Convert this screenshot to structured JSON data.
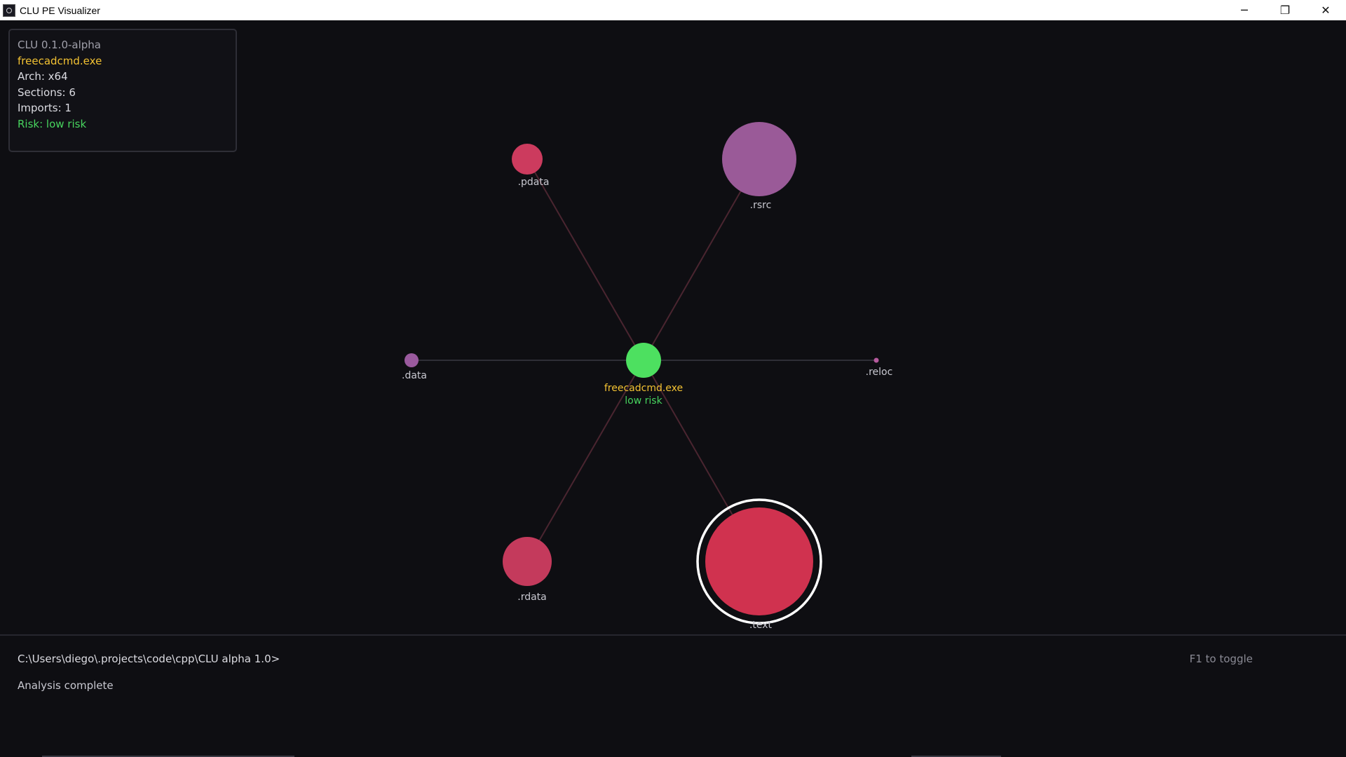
{
  "window": {
    "title": "CLU PE Visualizer",
    "minimize_glyph": "─",
    "maximize_glyph": "❐",
    "close_glyph": "✕"
  },
  "info": {
    "version": "CLU 0.1.0-alpha",
    "filename": "freecadcmd.exe",
    "arch": "Arch: x64",
    "sections": "Sections: 6",
    "imports": "Imports: 1",
    "risk": "Risk: low risk"
  },
  "graph": {
    "center": {
      "label": "freecadcmd.exe",
      "sublabel": "low risk",
      "color": "#4de060"
    },
    "edge_color": "#4a2530",
    "nodes": [
      {
        "label": ".pdata",
        "color": "#cc3b5e"
      },
      {
        "label": ".rsrc",
        "color": "#9a5a98"
      },
      {
        "label": ".data",
        "color": "#9a5a9e"
      },
      {
        "label": ".reloc",
        "color": "#b65a9e"
      },
      {
        "label": ".rdata",
        "color": "#c43a5c"
      },
      {
        "label": ".text",
        "color": "#d0324f",
        "selected": true
      }
    ]
  },
  "console": {
    "prompt": "C:\\Users\\diego\\.projects\\code\\cpp\\CLU alpha 1.0>",
    "status": "Analysis complete",
    "toggle_hint": "F1 to toggle"
  }
}
